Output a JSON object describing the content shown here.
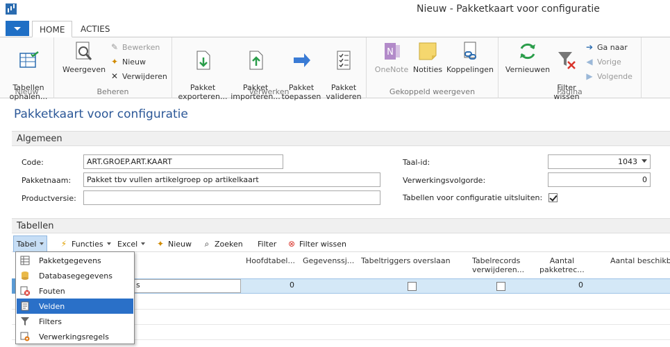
{
  "window": {
    "title": "Nieuw - Pakketkaart voor configuratie"
  },
  "ribbon": {
    "tabs": [
      {
        "label": "HOME"
      },
      {
        "label": "ACTIES"
      }
    ],
    "groups": {
      "nieuw": {
        "label": "Nieuw",
        "tabellen_ophalen": "Tabellen\nophalen..."
      },
      "beheren": {
        "label": "Beheren",
        "weergeven": "Weergeven",
        "bewerken": "Bewerken",
        "nieuw": "Nieuw",
        "verwijderen": "Verwijderen"
      },
      "verwerken": {
        "label": "Verwerken",
        "pakket_exporteren": "Pakket\nexporteren...",
        "pakket_importeren": "Pakket\nimporteren...",
        "pakket_toepassen": "Pakket\ntoepassen",
        "pakket_valideren": "Pakket\nvalideren"
      },
      "gekoppeld": {
        "label": "Gekoppeld weergeven",
        "onenote": "OneNote",
        "notities": "Notities",
        "koppelingen": "Koppelingen"
      },
      "pagina": {
        "label": "Pagina",
        "vernieuwen": "Vernieuwen",
        "filter_wissen": "Filter\nwissen",
        "ga_naar": "Ga naar",
        "vorige": "Vorige",
        "volgende": "Volgende"
      }
    }
  },
  "page": {
    "title": "Pakketkaart voor configuratie"
  },
  "algemeen": {
    "header": "Algemeen",
    "code_label": "Code:",
    "code_value": "ART.GROEP.ART.KAART",
    "pakketnaam_label": "Pakketnaam:",
    "pakketnaam_value": "Pakket tbv vullen artikelgroep op artikelkaart",
    "productversie_label": "Productversie:",
    "productversie_value": "",
    "taalid_label": "Taal-id:",
    "taalid_value": "1043",
    "volgorde_label": "Verwerkingsvolgorde:",
    "volgorde_value": "0",
    "uitsluiten_label": "Tabellen voor configuratie uitsluiten:",
    "uitsluiten_checked": true
  },
  "tabellen": {
    "header": "Tabellen",
    "toolbar": {
      "tabel": "Tabel",
      "functies": "Functies",
      "excel": "Excel",
      "nieuw": "Nieuw",
      "zoeken": "Zoeken",
      "filter": "Filter",
      "filter_wissen": "Filter wissen"
    },
    "columns": [
      "Hoofdtabel...",
      "Gegevenssj...",
      "Tabeltriggers overslaan",
      "Tabelrecords\nverwijderen...",
      "Aantal\npakketrec...",
      "Aantal beschikba"
    ],
    "row": {
      "name_fragment": "s",
      "hoofdtabel": "0",
      "aantal": "0",
      "triggers_checked": false,
      "verwijderen_checked": false
    }
  },
  "menu": {
    "items": [
      "Pakketgegevens",
      "Databasegegevens",
      "Fouten",
      "Velden",
      "Filters",
      "Verwerkingsregels"
    ],
    "highlighted": "Velden"
  },
  "colors": {
    "accent": "#2b5797",
    "menu_highlight": "#2a70c8",
    "app_button": "#1f6fc5",
    "selected_row": "#d4e8f7"
  }
}
